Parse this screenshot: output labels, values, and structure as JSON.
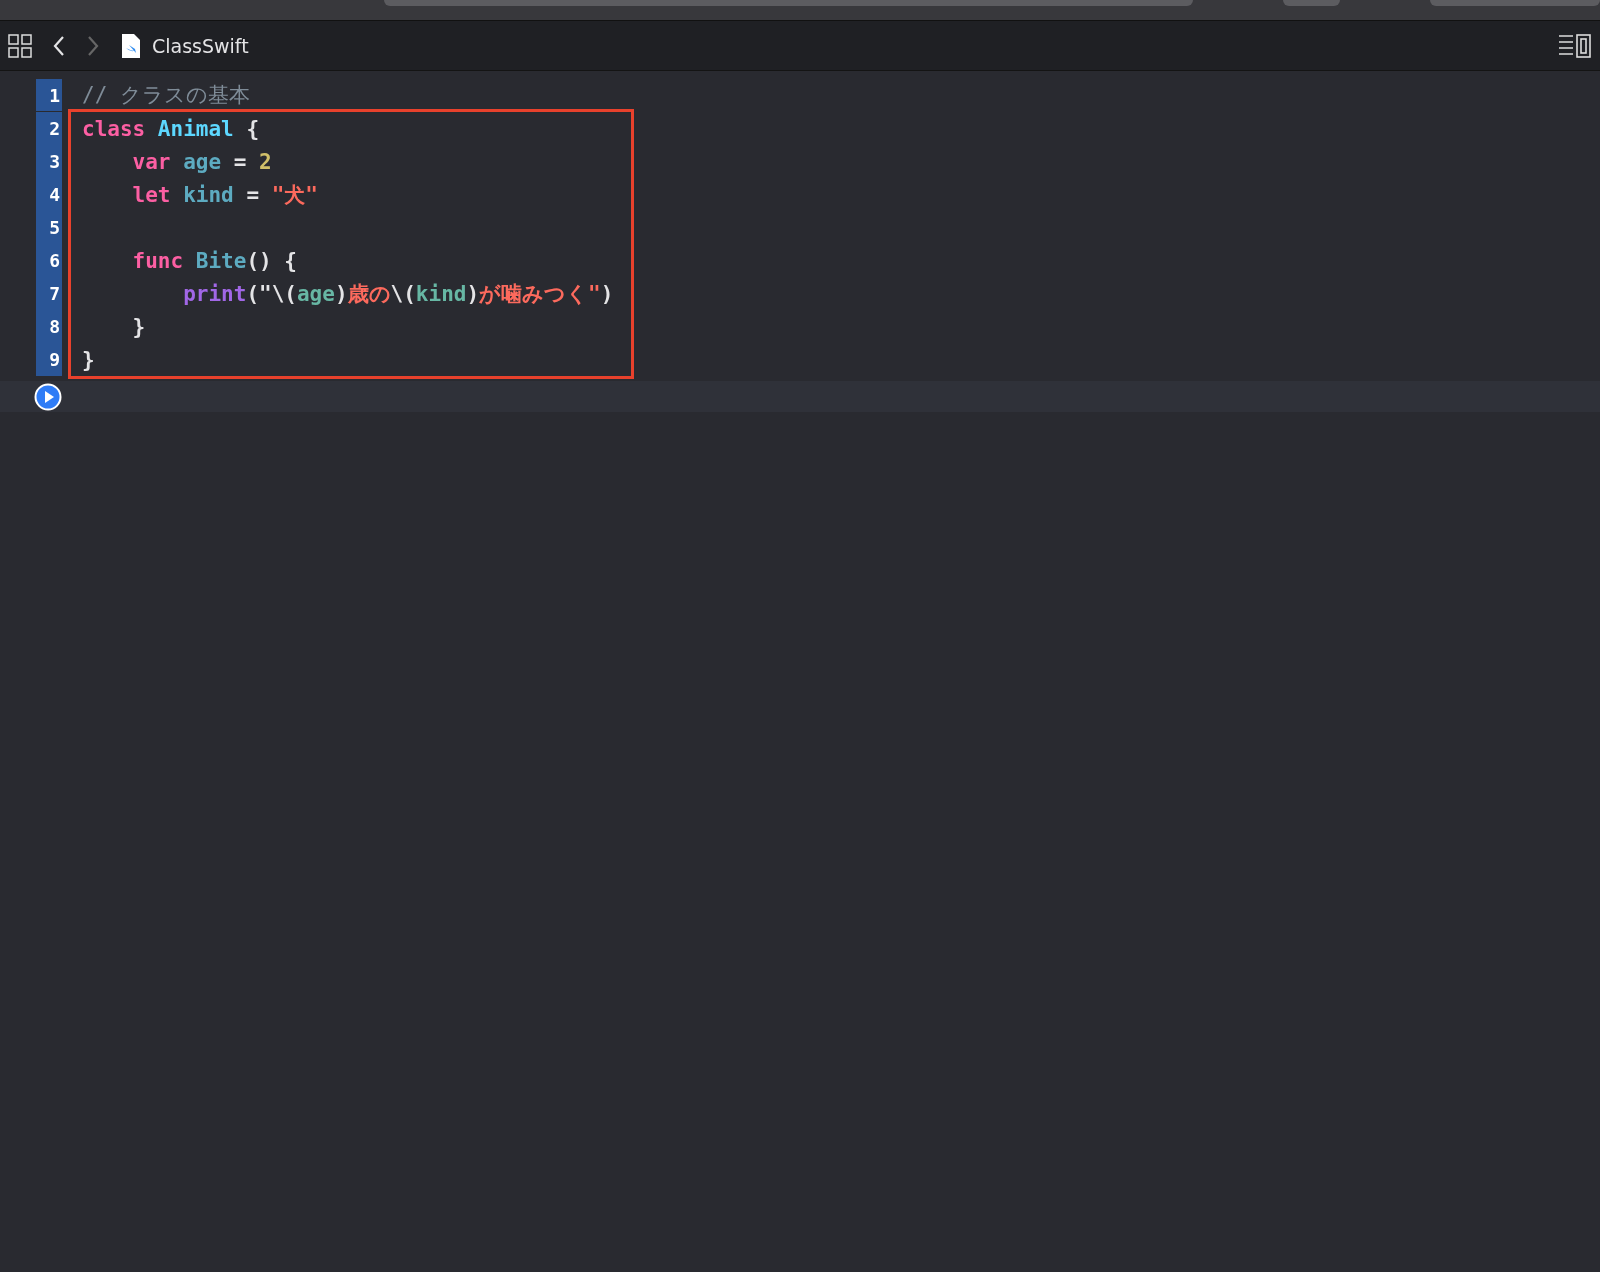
{
  "tab": {
    "title": "ClassSwift"
  },
  "lines": [
    {
      "number": "1",
      "tokens": [
        {
          "kind": "comment",
          "text": "// クラスの基本"
        }
      ]
    }
  ],
  "highlight_frame": {
    "lines": [
      {
        "number": "2",
        "tokens": [
          {
            "kind": "keyword",
            "text": "class"
          },
          {
            "kind": "type",
            "text": " Animal"
          },
          {
            "kind": "plain",
            "text": " {"
          }
        ]
      },
      {
        "number": "3",
        "tokens": [
          {
            "kind": "keyword",
            "text": "    var"
          },
          {
            "kind": "ident",
            "text": " age"
          },
          {
            "kind": "plain",
            "text": " = "
          },
          {
            "kind": "number",
            "text": "2"
          }
        ]
      },
      {
        "number": "4",
        "tokens": [
          {
            "kind": "keyword",
            "text": "    let"
          },
          {
            "kind": "ident",
            "text": " kind"
          },
          {
            "kind": "plain",
            "text": " = "
          },
          {
            "kind": "string",
            "text": "\"犬\""
          }
        ]
      },
      {
        "number": "5"
      },
      {
        "number": "6",
        "tokens": [
          {
            "kind": "keyword",
            "text": "    func"
          },
          {
            "kind": "ident",
            "text": " Bite"
          },
          {
            "kind": "plain",
            "text": "() {"
          }
        ]
      },
      {
        "number": "7",
        "tokens": [
          {
            "kind": "call",
            "text": "        print"
          },
          {
            "kind": "plain",
            "text": "(\"\\("
          },
          {
            "kind": "interp",
            "text": "age"
          },
          {
            "kind": "plain",
            "text": ")"
          },
          {
            "kind": "string",
            "text": "歳の"
          },
          {
            "kind": "plain",
            "text": "\\("
          },
          {
            "kind": "interp",
            "text": "kind"
          },
          {
            "kind": "plain",
            "text": ")"
          },
          {
            "kind": "string",
            "text": "が噛みつく\""
          },
          {
            "kind": "plain",
            "text": ")"
          }
        ]
      },
      {
        "number": "8",
        "tokens": [
          {
            "kind": "plain",
            "text": "    }"
          }
        ]
      },
      {
        "number": "9",
        "tokens": [
          {
            "kind": "plain",
            "text": "}"
          }
        ]
      }
    ]
  }
}
